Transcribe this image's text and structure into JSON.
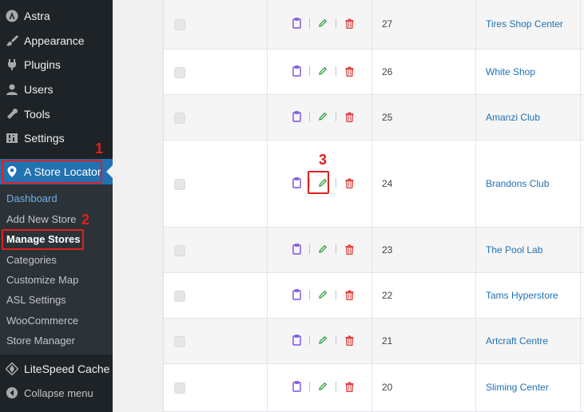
{
  "sidebar": {
    "menu": [
      {
        "label": "Astra",
        "icon": "astra-icon"
      },
      {
        "label": "Appearance",
        "icon": "paintbrush-icon"
      },
      {
        "label": "Plugins",
        "icon": "plugin-icon"
      },
      {
        "label": "Users",
        "icon": "user-icon"
      },
      {
        "label": "Tools",
        "icon": "wrench-icon"
      },
      {
        "label": "Settings",
        "icon": "settings-icon"
      }
    ],
    "active": {
      "label": "A Store Locator",
      "icon": "location-pin-icon"
    },
    "submenu": [
      {
        "label": "Dashboard"
      },
      {
        "label": "Add New Store"
      },
      {
        "label": "Manage Stores"
      },
      {
        "label": "Categories"
      },
      {
        "label": "Customize Map"
      },
      {
        "label": "ASL Settings"
      },
      {
        "label": "WooCommerce"
      },
      {
        "label": "Store Manager"
      }
    ],
    "litespeed": {
      "label": "LiteSpeed Cache",
      "icon": "litespeed-icon"
    },
    "collapse": {
      "label": "Collapse menu",
      "icon": "collapse-arrow-icon"
    }
  },
  "annotations": [
    "1",
    "2",
    "3"
  ],
  "table": {
    "rows": [
      {
        "id": "27",
        "name": "Tires Shop Center"
      },
      {
        "id": "26",
        "name": "White Shop"
      },
      {
        "id": "25",
        "name": "Amanzi Club"
      },
      {
        "id": "24",
        "name": "Brandons Club"
      },
      {
        "id": "23",
        "name": "The Pool Lab"
      },
      {
        "id": "22",
        "name": "Tams Hyperstore"
      },
      {
        "id": "21",
        "name": "Artcraft Centre"
      },
      {
        "id": "20",
        "name": "Sliming Center"
      }
    ]
  },
  "colors": {
    "sidebar_bg": "#1d2327",
    "active_bg": "#2271b1",
    "annotation": "#e02020",
    "copy_icon": "#7b4fe0",
    "edit_icon": "#2e9e3e",
    "delete_icon": "#e04040",
    "link": "#2271b1"
  }
}
